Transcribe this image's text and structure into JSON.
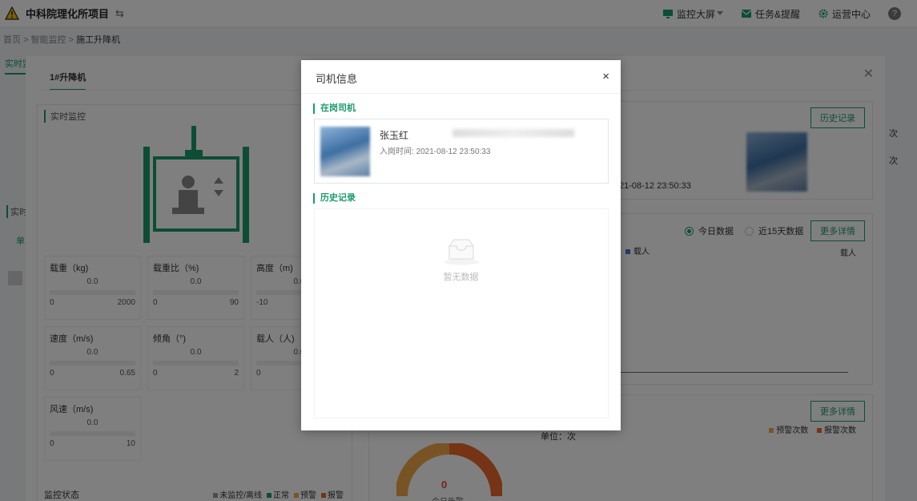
{
  "topbar": {
    "project_title": "中科院理化所项目",
    "swap_glyph": "⇆",
    "nav": [
      {
        "label": "监控大屏",
        "icon": "monitor-icon",
        "has_dropdown": true
      },
      {
        "label": "任务&提醒",
        "icon": "mail-icon"
      },
      {
        "label": "运营中心",
        "icon": "gear-icon"
      }
    ],
    "help_glyph": "?"
  },
  "breadcrumb": {
    "items": [
      "首页",
      "智能监控",
      "施工升降机"
    ],
    "separator": ">"
  },
  "sub_tab": "实时监",
  "panel": {
    "tab": "1#升降机",
    "realtime_title": "实时监控",
    "left_cut_title": "实时",
    "left_cut_tab": "单",
    "gauges": [
      {
        "title": "载重（kg)",
        "value": "0.0",
        "min": "0",
        "max": "2000"
      },
      {
        "title": "载重比（%)",
        "value": "0.0",
        "min": "0",
        "max": "90"
      },
      {
        "title": "高度（m)",
        "value": "0.0",
        "min": "-10",
        "max": ""
      },
      {
        "title": "速度（m/s)",
        "value": "0.0",
        "min": "0",
        "max": "0.65"
      },
      {
        "title": "倾角（°)",
        "value": "0.0",
        "min": "0",
        "max": "2"
      },
      {
        "title": "载人（人)",
        "value": "0.0",
        "min": "0",
        "max": ""
      },
      {
        "title": "风速（m/s)",
        "value": "0.0",
        "min": "0",
        "max": "10"
      }
    ],
    "status": {
      "label": "监控状态",
      "legend": [
        {
          "label": "未监控/离线",
          "color": "#999999"
        },
        {
          "label": "正常",
          "color": "#1a9b6c"
        },
        {
          "label": "预警",
          "color": "#f0a94a"
        },
        {
          "label": "报警",
          "color": "#e8692a"
        }
      ]
    },
    "driver_bg": {
      "history_button": "历史记录",
      "time_fragment": "21-08-12 23:50:33"
    },
    "chart_bg": {
      "more_button": "更多详情",
      "radio_today": "今日数据",
      "radio_15days": "近15天数据",
      "legend_item": "载人",
      "axis_label": "载人"
    },
    "alarm_bg": {
      "more_button": "更多详情",
      "unit": "单位：次",
      "legend": [
        {
          "label": "预警次数",
          "color": "#f0a94a"
        },
        {
          "label": "报警次数",
          "color": "#e8692a"
        }
      ],
      "donut_value": "0",
      "donut_label": "今日告警"
    },
    "right_cut": [
      "次",
      "次"
    ]
  },
  "modal": {
    "title": "司机信息",
    "close_glyph": "×",
    "on_duty_title": "在岗司机",
    "driver": {
      "name": "张玉红",
      "time_label": "入岗时间:",
      "time_value": "2021-08-12 23:50:33"
    },
    "history_title": "历史记录",
    "empty_text": "暂无数据"
  },
  "colors": {
    "accent": "#1a9b6c",
    "warning": "#f0a94a",
    "alarm": "#e8692a"
  }
}
